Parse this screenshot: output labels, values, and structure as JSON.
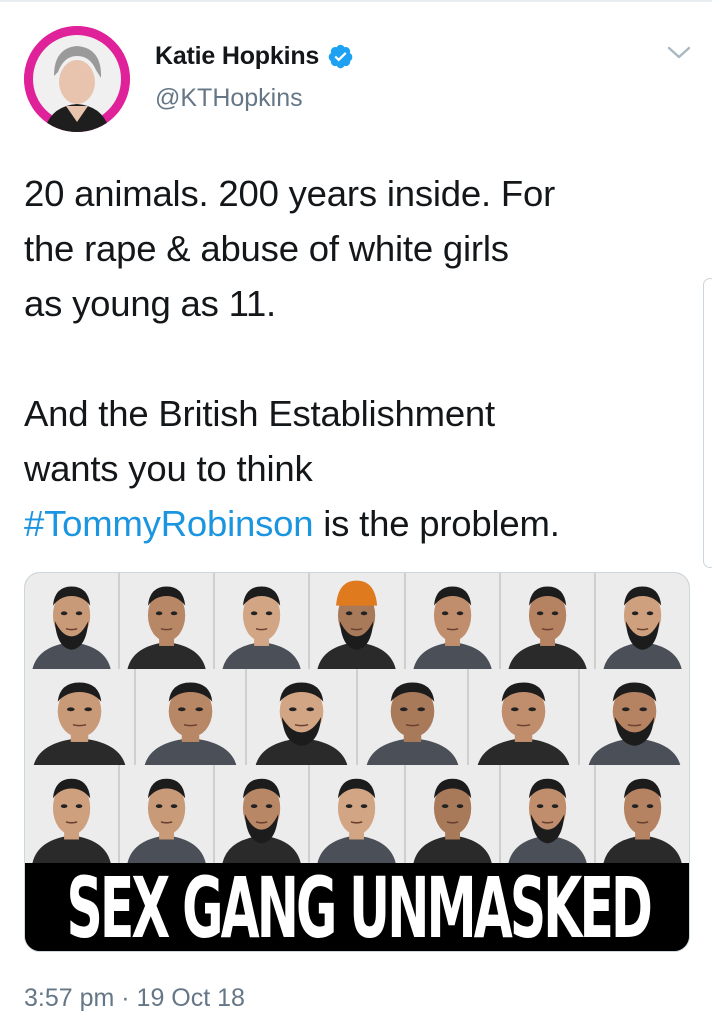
{
  "author": {
    "display_name": "Katie Hopkins",
    "handle": "@KTHopkins",
    "verified_icon": "verified-badge-icon",
    "avatar_ring_color": "#e0229a"
  },
  "menu": {
    "icon": "chevron-down-icon"
  },
  "tweet": {
    "lines": [
      "20 animals. 200 years inside. For",
      "the rape & abuse of white girls",
      "as young as 11.",
      "",
      "And the British Establishment",
      "wants you to think"
    ],
    "hashtag": "#TommyRobinson",
    "after_hashtag": " is the problem.",
    "hashtag_color": "#1b95e0"
  },
  "media": {
    "headline": "SEX GANG UNMASKED",
    "mugshot_count": 20
  },
  "meta": {
    "timestamp": "3:57 pm · 19 Oct 18"
  }
}
